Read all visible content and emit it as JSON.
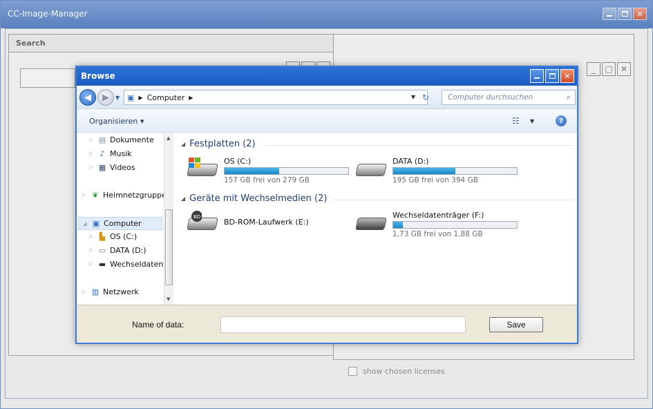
{
  "app": {
    "title": "CC-Image-Manager"
  },
  "search_panel": {
    "header": "Search"
  },
  "right_panel": {
    "license_label": "show chosen licenses"
  },
  "dialog": {
    "title": "Browse",
    "address": {
      "root": "Computer",
      "search_placeholder": "Computer durchsuchen"
    },
    "toolbar": {
      "organize": "Organisieren"
    },
    "nav": {
      "items": [
        {
          "label": "Dokumente",
          "icon": "document-icon"
        },
        {
          "label": "Musik",
          "icon": "music-icon"
        },
        {
          "label": "Videos",
          "icon": "video-icon"
        },
        {
          "label": "Heimnetzgruppe",
          "icon": "homegroup-icon"
        },
        {
          "label": "Computer",
          "icon": "computer-icon"
        },
        {
          "label": "OS (C:)",
          "icon": "os-drive-icon"
        },
        {
          "label": "DATA (D:)",
          "icon": "drive-icon"
        },
        {
          "label": "Wechseldatent",
          "icon": "removable-drive-icon"
        },
        {
          "label": "Netzwerk",
          "icon": "network-icon"
        }
      ]
    },
    "groups": {
      "hard_disks": {
        "title": "Festplatten (2)",
        "drives": [
          {
            "name": "OS (C:)",
            "free_text": "157 GB frei von 279 GB",
            "used_fraction": 0.44
          },
          {
            "name": "DATA (D:)",
            "free_text": "195 GB frei von 394 GB",
            "used_fraction": 0.5
          }
        ]
      },
      "removable": {
        "title": "Geräte mit Wechselmedien (2)",
        "drives": [
          {
            "name": "BD-ROM-Laufwerk (E:)",
            "free_text": "",
            "used_fraction": null
          },
          {
            "name": "Wechseldatenträger (F:)",
            "free_text": "1,73 GB frei von 1,88 GB",
            "used_fraction": 0.08
          }
        ]
      }
    },
    "save": {
      "name_label": "Name of data:",
      "name_value": "",
      "save_label": "Save"
    }
  },
  "colors": {
    "accent": "#1b5cc3",
    "progress": "#1c85c6"
  }
}
